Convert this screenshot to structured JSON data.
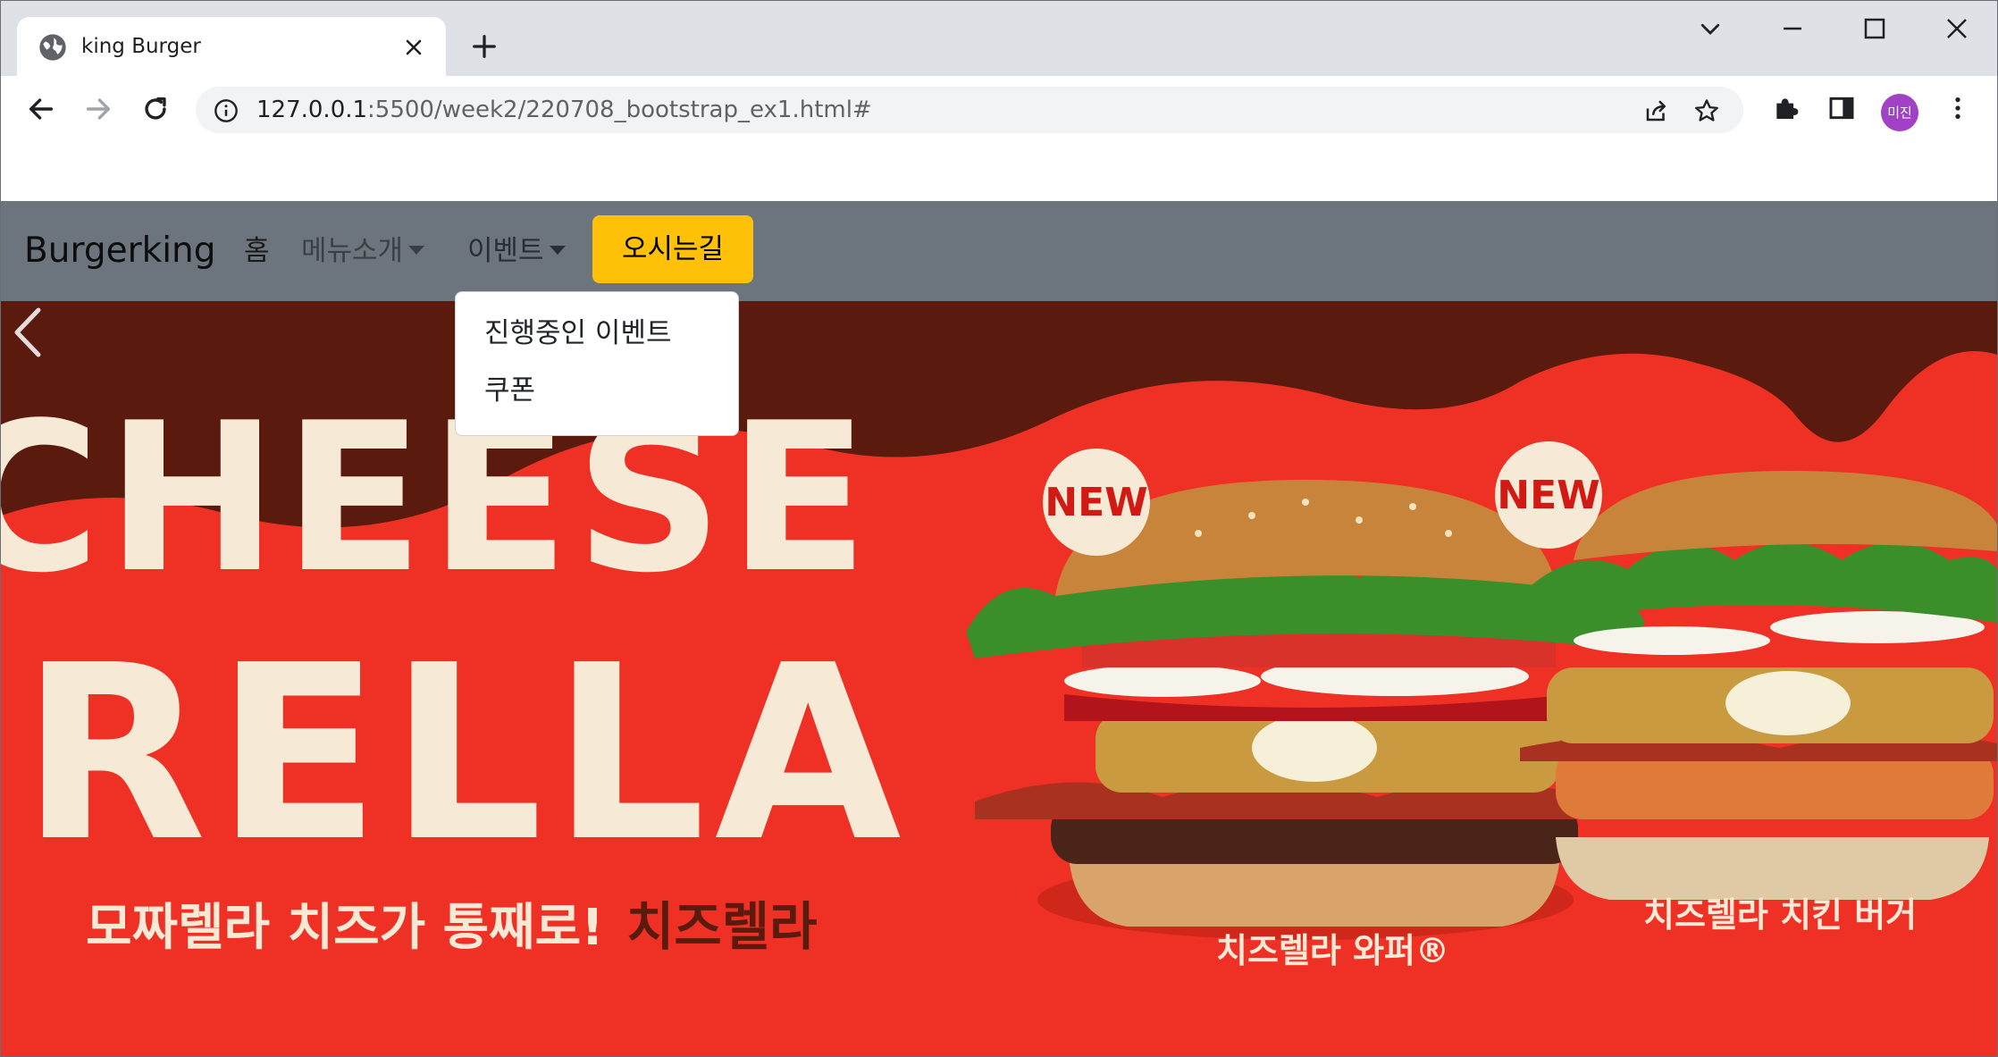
{
  "browser": {
    "tab_title": "king Burger",
    "url_host": "127.0.0.1",
    "url_rest": ":5500/week2/220708_bootstrap_ex1.html#",
    "profile_initials": "미진",
    "profile_color": "#a142c6"
  },
  "navbar": {
    "brand": "Burgerking",
    "home": "홈",
    "menu": "메뉴소개",
    "event": "이벤트",
    "directions": "오시는길",
    "background": "#6c757d",
    "accent": "#ffc107"
  },
  "dropdown": {
    "items": [
      "진행중인 이벤트",
      "쿠폰"
    ]
  },
  "banner": {
    "headline_1": "CHEESE",
    "headline_2": "RELLA",
    "tagline": "모짜렐라 치즈가 통째로!",
    "tagline_brand": "치즈렐라",
    "badge_1": "NEW",
    "badge_2": "NEW",
    "product_1": "치즈렐라 와퍼®",
    "product_2": "치즈렐라 치킨 버거",
    "colors": {
      "dark": "#5a1a0e",
      "red": "#ee3124",
      "cream": "#f6e9d6"
    }
  }
}
